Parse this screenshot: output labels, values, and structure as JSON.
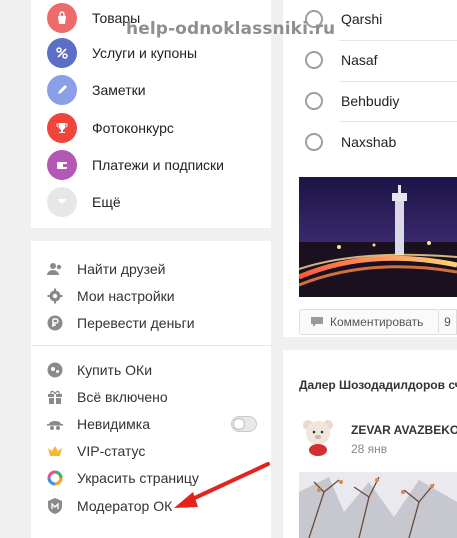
{
  "watermark": "help-odnoklassniki.ru",
  "main_menu": [
    {
      "label": "Товары",
      "icon": "shopping-bag-icon",
      "color": "#ef6b6b"
    },
    {
      "label": "Услуги и купоны",
      "icon": "percent-icon",
      "color": "#5b6fc6"
    },
    {
      "label": "Заметки",
      "icon": "pencil-icon",
      "color": "#8b9fe8"
    },
    {
      "label": "Фотоконкурс",
      "icon": "trophy-icon",
      "color": "#f0453a"
    },
    {
      "label": "Платежи и подписки",
      "icon": "wallet-icon",
      "color": "#b458b6"
    },
    {
      "label": "Ещё",
      "icon": "chevron-down-icon",
      "color": "#e7e7e7"
    }
  ],
  "settings_menu": [
    {
      "label": "Найти друзей",
      "icon": "friends-icon"
    },
    {
      "label": "Мои настройки",
      "icon": "gear-icon"
    },
    {
      "label": "Перевести деньги",
      "icon": "ruble-icon"
    }
  ],
  "extras_menu": [
    {
      "label": "Купить ОКи",
      "icon": "ok-coins-icon"
    },
    {
      "label": "Всё включено",
      "icon": "gift-icon"
    },
    {
      "label": "Невидимка",
      "icon": "invisible-icon",
      "toggle": false
    },
    {
      "label": "VIP-статус",
      "icon": "crown-icon"
    },
    {
      "label": "Украсить страницу",
      "icon": "palette-ring-icon"
    },
    {
      "label": "Модератор ОК",
      "icon": "shield-icon"
    }
  ],
  "poll": {
    "options": [
      "Qarshi",
      "Nasaf",
      "Behbudiy",
      "Naxshab"
    ]
  },
  "post_actions": {
    "comment_label": "Комментировать",
    "comment_count": "9"
  },
  "feed2": {
    "header": "Далер Шозодадилдоров сч",
    "author": "ZEVAR AVAZBEKOV",
    "date": "28 янв"
  },
  "colors": {
    "arrow": "#e3231c",
    "ok_orange": "#f7931e"
  }
}
